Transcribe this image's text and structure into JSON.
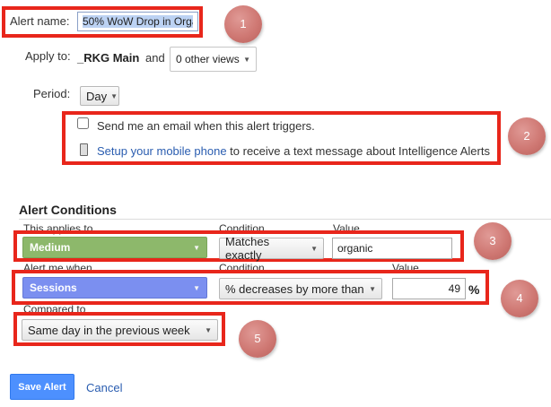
{
  "alert_name": {
    "label": "Alert name:",
    "value": "50% WoW Drop in Orga"
  },
  "apply_to": {
    "label": "Apply to:",
    "property": "_RKG Main",
    "and": "and",
    "views_select": "0 other views"
  },
  "period": {
    "label": "Period:",
    "value": "Day"
  },
  "notifications": {
    "email_label": "Send me an email when this alert triggers.",
    "mobile_link": "Setup your mobile phone",
    "mobile_text": "to receive a text message about Intelligence Alerts"
  },
  "conditions": {
    "title": "Alert Conditions",
    "applies_to_header": "This applies to",
    "condition_header": "Condition",
    "value_header": "Value",
    "dimension": "Medium",
    "match_type": "Matches exactly",
    "match_value": "organic",
    "alert_when_header": "Alert me when",
    "condition_header_2": "Condition",
    "value_header_2": "Value",
    "metric": "Sessions",
    "metric_condition": "% decreases by more than",
    "metric_value": "49",
    "percent_sign": "%",
    "compared_to_header": "Compared to",
    "compared_to": "Same day in the previous week"
  },
  "actions": {
    "save": "Save Alert",
    "cancel": "Cancel"
  },
  "callouts": [
    "1",
    "2",
    "3",
    "4",
    "5"
  ],
  "colors": {
    "highlight": "#e8261b",
    "callout": "#cf7873",
    "dimension_chip": "#8db86b",
    "metric_chip": "#7b8ff0",
    "link": "#2a5db0",
    "save_button": "#4d90fe"
  }
}
